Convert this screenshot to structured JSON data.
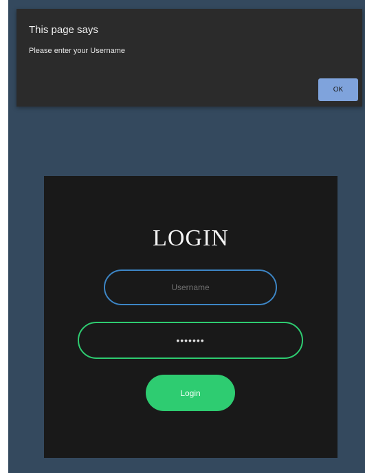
{
  "alert": {
    "title": "This page says",
    "message": "Please enter your Username",
    "ok_label": "OK"
  },
  "login": {
    "heading": "LOGIN",
    "username_placeholder": "Username",
    "username_value": "",
    "password_value": "•••••••",
    "button_label": "Login"
  },
  "colors": {
    "page_background": "#34495e",
    "card_background": "#191919",
    "username_border": "#3d86c6",
    "password_border": "#2ecc71",
    "login_button": "#2ecc71",
    "ok_button": "#7fa3dc"
  }
}
